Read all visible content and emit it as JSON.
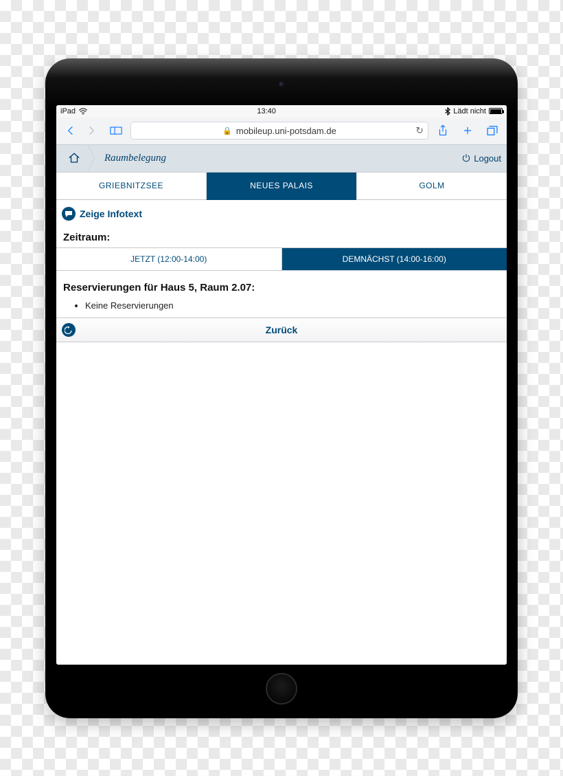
{
  "statusbar": {
    "device": "iPad",
    "time": "13:40",
    "battery_text": "Lädt nicht"
  },
  "safari": {
    "address": "mobileup.uni-potsdam.de"
  },
  "header": {
    "breadcrumb": "Raumbelegung",
    "logout": "Logout"
  },
  "tabs": {
    "items": [
      {
        "label": "GRIEBNITZSEE",
        "active": false
      },
      {
        "label": "NEUES PALAIS",
        "active": true
      },
      {
        "label": "GOLM",
        "active": false
      }
    ]
  },
  "infotext": {
    "label": "Zeige Infotext"
  },
  "zeitraum": {
    "heading": "Zeitraum:",
    "options": [
      {
        "label": "JETZT (12:00-14:00)",
        "active": false
      },
      {
        "label": "DEMNÄCHST (14:00-16:00)",
        "active": true
      }
    ]
  },
  "reservations": {
    "heading": "Reservierungen für Haus 5, Raum 2.07:",
    "items": [
      "Keine Reservierungen"
    ]
  },
  "back": {
    "label": "Zurück"
  }
}
